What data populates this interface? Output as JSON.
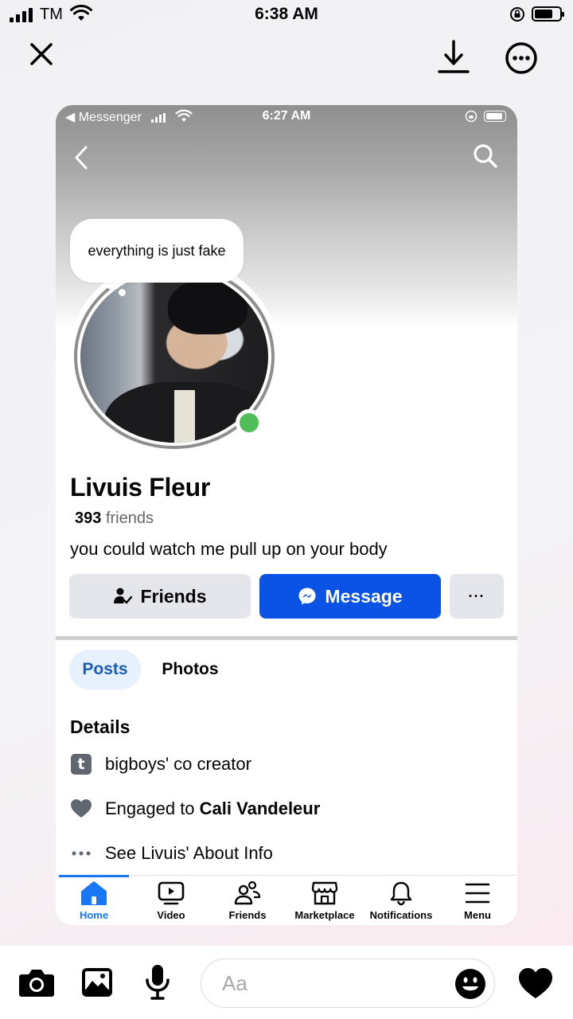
{
  "status_bar": {
    "carrier": "TM",
    "time": "6:38 AM"
  },
  "viewer": {
    "close_icon": "close-icon",
    "download_icon": "download-icon",
    "more_icon": "more-circle-icon"
  },
  "screenshot": {
    "status_bar": {
      "back_app": "◀ Messenger",
      "time": "6:27 AM"
    },
    "profile": {
      "note": "everything is just fake",
      "name": "Livuis Fleur",
      "friends_count": "393",
      "friends_label": "friends",
      "bio": "you could watch me pull up on your body"
    },
    "actions": {
      "friends_label": "Friends",
      "message_label": "Message",
      "more_label": "···"
    },
    "tabs": [
      {
        "label": "Posts"
      },
      {
        "label": "Photos"
      }
    ],
    "details": {
      "title": "Details",
      "items": [
        {
          "icon": "tumblr-icon",
          "text": "bigboys' co creator"
        },
        {
          "icon": "heart-icon",
          "text": "Engaged to ",
          "bold": "Cali Vandeleur"
        },
        {
          "icon": "ellipsis-icon",
          "text": "See Livuis' About Info"
        }
      ]
    },
    "bottom_nav": [
      {
        "label": "Home",
        "icon": "home-icon",
        "active": true
      },
      {
        "label": "Video",
        "icon": "video-icon"
      },
      {
        "label": "Friends",
        "icon": "friends-icon"
      },
      {
        "label": "Marketplace",
        "icon": "marketplace-icon"
      },
      {
        "label": "Notifications",
        "icon": "bell-icon"
      },
      {
        "label": "Menu",
        "icon": "menu-icon"
      }
    ],
    "colors": {
      "accent": "#0a53e4",
      "online": "#4fbe56",
      "nav_active": "#1877f2"
    }
  },
  "composer": {
    "placeholder": "Aa",
    "icons": [
      "camera-icon",
      "gallery-icon",
      "microphone-icon",
      "emoji-icon",
      "heart-icon"
    ]
  }
}
